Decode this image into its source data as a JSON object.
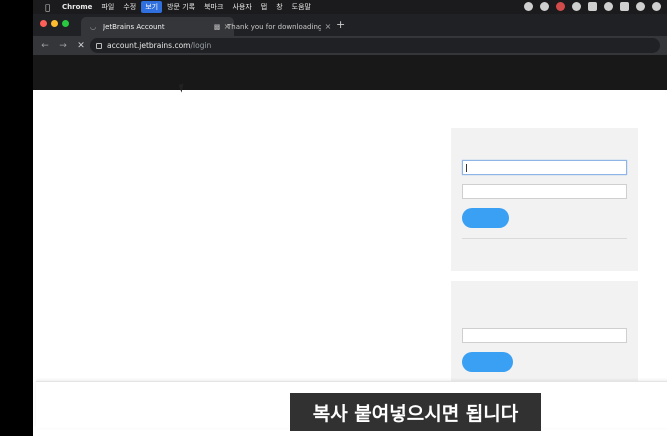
{
  "menubar": {
    "app_name": "Chrome",
    "items": [
      "파일",
      "수정",
      "보기",
      "방문 기록",
      "북마크",
      "사용자",
      "탭",
      "창",
      "도움말"
    ],
    "active_item": "보기"
  },
  "tabs": [
    {
      "title": "JetBrains Account",
      "active": true,
      "favicon": "loading-spinner-icon"
    },
    {
      "title": "Thank you for downloading Py",
      "active": false,
      "favicon": "pycharm-icon"
    }
  ],
  "newtab_label": "+",
  "close_glyph": "×",
  "toolbar": {
    "url_domain": "account.jetbrains.com",
    "url_path": "/login"
  },
  "colors": {
    "traffic_red": "#ff5f57",
    "traffic_yellow": "#febc2e",
    "traffic_green": "#28c840",
    "button_blue": "#3aa0f3"
  },
  "subtitle": "복사 붙여넣으시면 됩니다"
}
